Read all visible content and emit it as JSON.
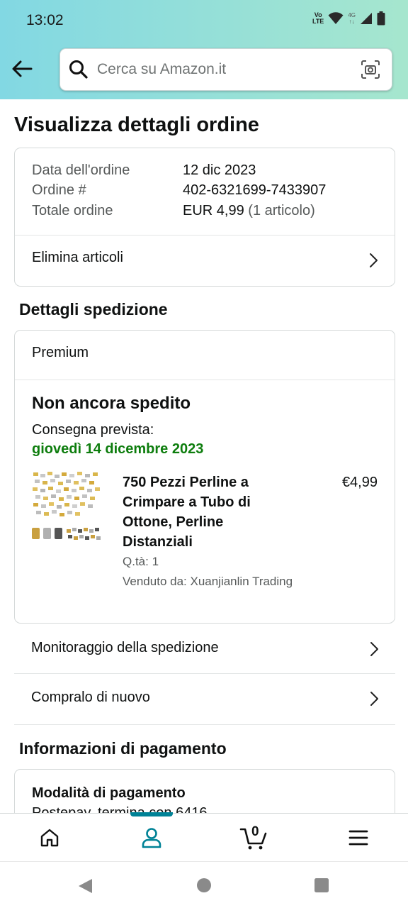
{
  "status_bar": {
    "time": "13:02",
    "volte_label_top": "Vo",
    "volte_label_bottom": "LTE",
    "network_label_top": "4G",
    "network_label_bottom": "↑↓",
    "icons": [
      "volte-icon",
      "wifi-icon",
      "signal-icon",
      "battery-icon"
    ]
  },
  "header": {
    "search_placeholder": "Cerca su Amazon.it",
    "back_icon": "arrow-left-icon",
    "search_icon": "search-icon",
    "camera_icon": "camera-scan-icon"
  },
  "page": {
    "title": "Visualizza dettagli ordine"
  },
  "order_summary": {
    "date_label": "Data dell'ordine",
    "date_value": "12 dic 2023",
    "number_label": "Ordine #",
    "number_value": "402-6321699-7433907",
    "total_label": "Totale ordine",
    "total_value": "EUR 4,99",
    "total_items": "(1 articolo)",
    "remove_items_label": "Elimina articoli"
  },
  "shipment": {
    "section_title": "Dettagli spedizione",
    "shipping_type": "Premium",
    "status": "Non ancora spedito",
    "delivery_label": "Consegna prevista:",
    "delivery_date": "giovedì 14 dicembre 2023",
    "item": {
      "name": "750 Pezzi Perline a Crimpare a Tubo di Ottone, Perline Distanziali",
      "price": "€4,99",
      "quantity": "Q.tà: 1",
      "seller": "Venduto da: Xuanjianlin Trading"
    },
    "track_label": "Monitoraggio della spedizione",
    "buy_again_label": "Compralo di nuovo"
  },
  "payment": {
    "section_title": "Informazioni di pagamento",
    "method_label": "Modalità di pagamento",
    "method_value": "Postepay, termina con 6416"
  },
  "bottom_nav": {
    "cart_count": "0",
    "items": [
      "home-icon",
      "account-icon",
      "cart-icon",
      "menu-icon"
    ],
    "active_color": "#008296"
  },
  "colors": {
    "delivery_green": "#0d7d0d",
    "header_gradient_start": "#82d8e3",
    "header_gradient_end": "#a6e6ce"
  }
}
